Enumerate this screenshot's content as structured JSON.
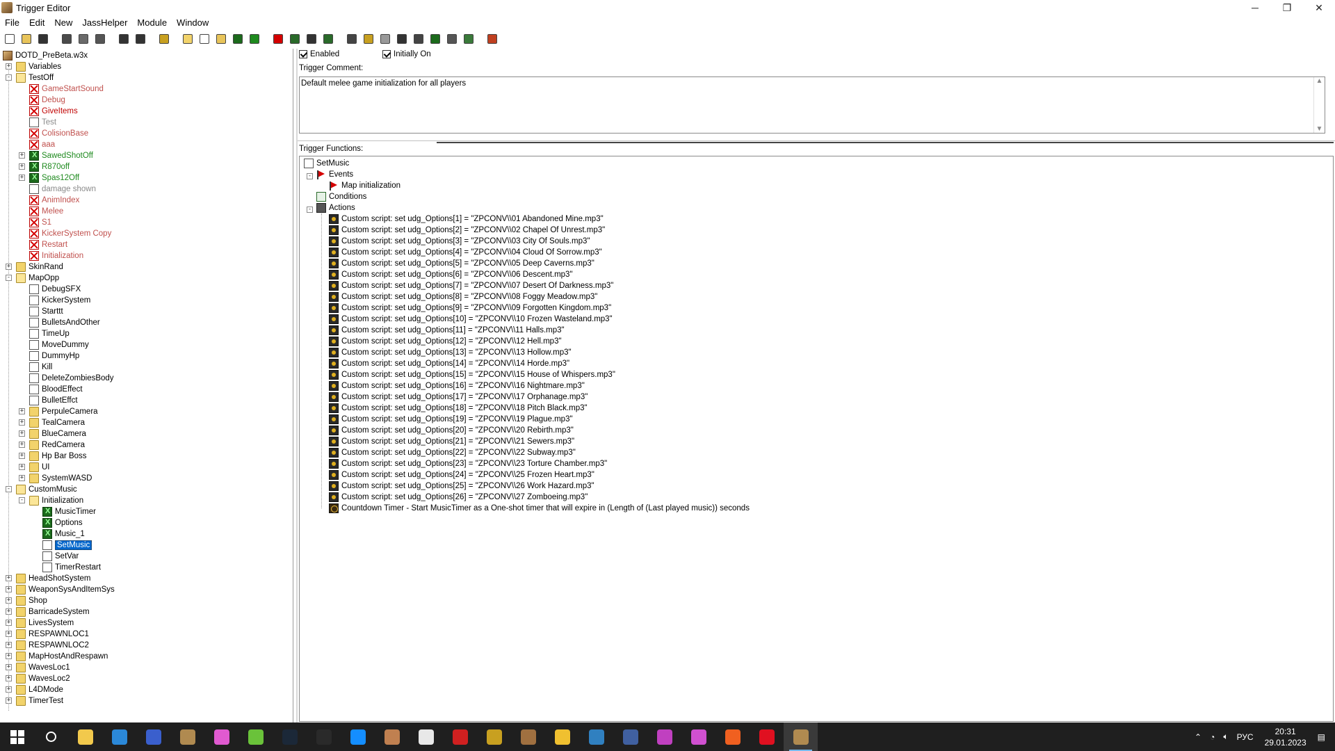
{
  "window": {
    "title": "Trigger Editor",
    "controls": [
      "─",
      "❐",
      "✕"
    ]
  },
  "menu": [
    "File",
    "Edit",
    "New",
    "JassHelper",
    "Module",
    "Window"
  ],
  "toolbar": {
    "buttons": [
      {
        "icon": "new-icon",
        "color": "#ffffff"
      },
      {
        "icon": "open-icon",
        "color": "#e8c45a"
      },
      {
        "icon": "save-icon",
        "color": "#333333"
      },
      {
        "icon": "cut-icon",
        "color": "#4a4a4a"
      },
      {
        "icon": "copy-icon",
        "color": "#6a6a6a"
      },
      {
        "icon": "paste-icon",
        "color": "#555555"
      },
      {
        "icon": "undo-icon",
        "color": "#333333"
      },
      {
        "icon": "redo-icon",
        "color": "#333333"
      },
      {
        "icon": "delete-icon",
        "color": "#c8a020"
      },
      {
        "icon": "new-category-icon",
        "color": "#f2d36b"
      },
      {
        "icon": "new-trigger-icon",
        "color": "#ffffff"
      },
      {
        "icon": "new-comment-icon",
        "color": "#e8c45a"
      },
      {
        "icon": "new-variable-icon",
        "color": "#1c6a1c"
      },
      {
        "icon": "jass-icon",
        "color": "#1e8a1e"
      },
      {
        "icon": "event-icon",
        "color": "#d40000"
      },
      {
        "icon": "condition-icon",
        "color": "#2a6a2a"
      },
      {
        "icon": "action-icon",
        "color": "#333333"
      },
      {
        "icon": "checklist-icon",
        "color": "#2a6a2a"
      },
      {
        "icon": "terrain-icon",
        "color": "#444444"
      },
      {
        "icon": "object-icon",
        "color": "#c8a020"
      },
      {
        "icon": "sound-icon",
        "color": "#999999"
      },
      {
        "icon": "ai-icon",
        "color": "#333333"
      },
      {
        "icon": "campaign-icon",
        "color": "#444444"
      },
      {
        "icon": "import-icon",
        "color": "#1c6a1c"
      },
      {
        "icon": "object-manager-icon",
        "color": "#555555"
      },
      {
        "icon": "test-map-icon",
        "color": "#3a7a3a"
      },
      {
        "icon": "script-test-icon",
        "color": "#c04020"
      }
    ]
  },
  "tree": {
    "root": "DOTD_PreBeta.w3x",
    "items": [
      {
        "label": "Variables",
        "icon": "folder-icon",
        "style": "normal",
        "level": 1,
        "expander": "+"
      },
      {
        "label": "TestOff",
        "icon": "folder-open-icon",
        "style": "normal",
        "level": 1,
        "expander": "-"
      },
      {
        "label": "GameStartSound",
        "icon": "disabled-trigger-icon",
        "style": "disabled",
        "level": 2,
        "expander": ""
      },
      {
        "label": "Debug",
        "icon": "disabled-trigger-icon",
        "style": "disabled",
        "level": 2,
        "expander": ""
      },
      {
        "label": "GiveItems",
        "icon": "disabled-trigger-icon",
        "style": "disabled-strong",
        "level": 2,
        "expander": ""
      },
      {
        "label": "Test",
        "icon": "document-icon",
        "style": "gray",
        "level": 2,
        "expander": ""
      },
      {
        "label": "ColisionBase",
        "icon": "disabled-trigger-icon",
        "style": "disabled",
        "level": 2,
        "expander": ""
      },
      {
        "label": "aaa",
        "icon": "disabled-trigger-icon",
        "style": "disabled",
        "level": 2,
        "expander": ""
      },
      {
        "label": "SawedShotOff",
        "icon": "jass-trigger-icon",
        "style": "green",
        "level": 2,
        "expander": "+"
      },
      {
        "label": "R870off",
        "icon": "jass-trigger-icon",
        "style": "green",
        "level": 2,
        "expander": "+"
      },
      {
        "label": "Spas12Off",
        "icon": "jass-trigger-icon",
        "style": "green",
        "level": 2,
        "expander": "+"
      },
      {
        "label": "damage shown",
        "icon": "document-icon",
        "style": "gray",
        "level": 2,
        "expander": ""
      },
      {
        "label": "AnimIndex",
        "icon": "disabled-trigger-icon",
        "style": "disabled",
        "level": 2,
        "expander": ""
      },
      {
        "label": "Melee",
        "icon": "disabled-trigger-icon",
        "style": "disabled",
        "level": 2,
        "expander": ""
      },
      {
        "label": "S1",
        "icon": "disabled-trigger-icon",
        "style": "disabled",
        "level": 2,
        "expander": ""
      },
      {
        "label": "KickerSystem Copy",
        "icon": "disabled-trigger-icon",
        "style": "disabled",
        "level": 2,
        "expander": ""
      },
      {
        "label": "Restart",
        "icon": "disabled-trigger-icon",
        "style": "disabled",
        "level": 2,
        "expander": ""
      },
      {
        "label": "Initialization",
        "icon": "disabled-trigger-icon",
        "style": "disabled",
        "level": 2,
        "expander": ""
      },
      {
        "label": "SkinRand",
        "icon": "folder-icon",
        "style": "normal",
        "level": 1,
        "expander": "+"
      },
      {
        "label": "MapOpp",
        "icon": "folder-open-icon",
        "style": "normal",
        "level": 1,
        "expander": "-"
      },
      {
        "label": "DebugSFX",
        "icon": "document-icon",
        "style": "normal",
        "level": 2,
        "expander": ""
      },
      {
        "label": "KickerSystem",
        "icon": "document-icon",
        "style": "normal",
        "level": 2,
        "expander": ""
      },
      {
        "label": "Starttt",
        "icon": "document-icon",
        "style": "normal",
        "level": 2,
        "expander": ""
      },
      {
        "label": "BulletsAndOther",
        "icon": "document-icon",
        "style": "normal",
        "level": 2,
        "expander": ""
      },
      {
        "label": "TimeUp",
        "icon": "document-icon",
        "style": "normal",
        "level": 2,
        "expander": ""
      },
      {
        "label": "MoveDummy",
        "icon": "document-icon",
        "style": "normal",
        "level": 2,
        "expander": ""
      },
      {
        "label": "DummyHp",
        "icon": "document-icon",
        "style": "normal",
        "level": 2,
        "expander": ""
      },
      {
        "label": "Kill",
        "icon": "document-icon",
        "style": "normal",
        "level": 2,
        "expander": ""
      },
      {
        "label": "DeleteZombiesBody",
        "icon": "document-icon",
        "style": "normal",
        "level": 2,
        "expander": ""
      },
      {
        "label": "BloodEffect",
        "icon": "document-icon",
        "style": "normal",
        "level": 2,
        "expander": ""
      },
      {
        "label": "BulletEffct",
        "icon": "document-icon",
        "style": "normal",
        "level": 2,
        "expander": ""
      },
      {
        "label": "PerpuleCamera",
        "icon": "folder-icon",
        "style": "normal",
        "level": 2,
        "expander": "+"
      },
      {
        "label": "TealCamera",
        "icon": "folder-icon",
        "style": "normal",
        "level": 2,
        "expander": "+"
      },
      {
        "label": "BlueCamera",
        "icon": "folder-icon",
        "style": "normal",
        "level": 2,
        "expander": "+"
      },
      {
        "label": "RedCamera",
        "icon": "folder-icon",
        "style": "normal",
        "level": 2,
        "expander": "+"
      },
      {
        "label": "Hp Bar Boss",
        "icon": "folder-icon",
        "style": "normal",
        "level": 2,
        "expander": "+"
      },
      {
        "label": "UI",
        "icon": "folder-icon",
        "style": "normal",
        "level": 2,
        "expander": "+"
      },
      {
        "label": "SystemWASD",
        "icon": "folder-icon",
        "style": "normal",
        "level": 2,
        "expander": "+"
      },
      {
        "label": "CustomMusic",
        "icon": "folder-open-icon",
        "style": "normal",
        "level": 1,
        "expander": "-"
      },
      {
        "label": "Initialization",
        "icon": "folder-open-icon",
        "style": "normal",
        "level": 2,
        "expander": "-"
      },
      {
        "label": "MusicTimer",
        "icon": "jass-trigger-icon",
        "style": "normal",
        "level": 3,
        "expander": ""
      },
      {
        "label": "Options",
        "icon": "jass-trigger-icon",
        "style": "normal",
        "level": 3,
        "expander": ""
      },
      {
        "label": "Music_1",
        "icon": "jass-trigger-icon",
        "style": "normal",
        "level": 3,
        "expander": ""
      },
      {
        "label": "SetMusic",
        "icon": "document-icon",
        "style": "selected",
        "level": 3,
        "expander": ""
      },
      {
        "label": "SetVar",
        "icon": "document-icon",
        "style": "normal",
        "level": 3,
        "expander": ""
      },
      {
        "label": "TimerRestart",
        "icon": "document-icon",
        "style": "normal",
        "level": 3,
        "expander": ""
      },
      {
        "label": "HeadShotSystem",
        "icon": "folder-icon",
        "style": "normal",
        "level": 1,
        "expander": "+"
      },
      {
        "label": "WeaponSysAndItemSys",
        "icon": "folder-icon",
        "style": "normal",
        "level": 1,
        "expander": "+"
      },
      {
        "label": "Shop",
        "icon": "folder-icon",
        "style": "normal",
        "level": 1,
        "expander": "+"
      },
      {
        "label": "BarricadeSystem",
        "icon": "folder-icon",
        "style": "normal",
        "level": 1,
        "expander": "+"
      },
      {
        "label": "LivesSystem",
        "icon": "folder-icon",
        "style": "normal",
        "level": 1,
        "expander": "+"
      },
      {
        "label": "RESPAWNLOC1",
        "icon": "folder-icon",
        "style": "normal",
        "level": 1,
        "expander": "+"
      },
      {
        "label": "RESPAWNLOC2",
        "icon": "folder-icon",
        "style": "normal",
        "level": 1,
        "expander": "+"
      },
      {
        "label": "MapHostAndRespawn",
        "icon": "folder-icon",
        "style": "normal",
        "level": 1,
        "expander": "+"
      },
      {
        "label": "WavesLoc1",
        "icon": "folder-icon",
        "style": "normal",
        "level": 1,
        "expander": "+"
      },
      {
        "label": "WavesLoc2",
        "icon": "folder-icon",
        "style": "normal",
        "level": 1,
        "expander": "+"
      },
      {
        "label": "L4DMode",
        "icon": "folder-icon",
        "style": "normal",
        "level": 1,
        "expander": "+"
      },
      {
        "label": "TimerTest",
        "icon": "folder-icon",
        "style": "normal",
        "level": 1,
        "expander": "+"
      }
    ]
  },
  "trigger": {
    "enabled_label": "Enabled",
    "initially_on_label": "Initially On",
    "comment_label": "Trigger Comment:",
    "comment": "Default melee game initialization for all players",
    "functions_label": "Trigger Functions:",
    "name": "SetMusic",
    "events_label": "Events",
    "events": [
      "Map initialization"
    ],
    "conditions_label": "Conditions",
    "actions_label": "Actions",
    "actions": [
      "Custom script:   set udg_Options[1] = \"ZPCONV\\\\01 Abandoned Mine.mp3\"",
      "Custom script:   set udg_Options[2] = \"ZPCONV\\\\02 Chapel Of Unrest.mp3\"",
      "Custom script:   set udg_Options[3] = \"ZPCONV\\\\03 City Of Souls.mp3\"",
      "Custom script:   set udg_Options[4] = \"ZPCONV\\\\04 Cloud Of Sorrow.mp3\"",
      "Custom script:   set udg_Options[5] = \"ZPCONV\\\\05 Deep Caverns.mp3\"",
      "Custom script:   set udg_Options[6] = \"ZPCONV\\\\06 Descent.mp3\"",
      "Custom script:   set udg_Options[7] = \"ZPCONV\\\\07 Desert Of Darkness.mp3\"",
      "Custom script:   set udg_Options[8] = \"ZPCONV\\\\08 Foggy Meadow.mp3\"",
      "Custom script:   set udg_Options[9] = \"ZPCONV\\\\09 Forgotten Kingdom.mp3\"",
      "Custom script:   set udg_Options[10] = \"ZPCONV\\\\10 Frozen Wasteland.mp3\"",
      "Custom script:   set udg_Options[11] = \"ZPCONV\\\\11 Halls.mp3\"",
      "Custom script:   set udg_Options[12] = \"ZPCONV\\\\12 Hell.mp3\"",
      "Custom script:   set udg_Options[13] = \"ZPCONV\\\\13 Hollow.mp3\"",
      "Custom script:   set udg_Options[14] = \"ZPCONV\\\\14 Horde.mp3\"",
      "Custom script:   set udg_Options[15] = \"ZPCONV\\\\15 House of Whispers.mp3\"",
      "Custom script:   set udg_Options[16] = \"ZPCONV\\\\16 Nightmare.mp3\"",
      "Custom script:   set udg_Options[17] = \"ZPCONV\\\\17 Orphanage.mp3\"",
      "Custom script:   set udg_Options[18] = \"ZPCONV\\\\18 Pitch Black.mp3\"",
      "Custom script:   set udg_Options[19] = \"ZPCONV\\\\19 Plague.mp3\"",
      "Custom script:   set udg_Options[20] = \"ZPCONV\\\\20 Rebirth.mp3\"",
      "Custom script:   set udg_Options[21] = \"ZPCONV\\\\21 Sewers.mp3\"",
      "Custom script:   set udg_Options[22] = \"ZPCONV\\\\22 Subway.mp3\"",
      "Custom script:   set udg_Options[23] = \"ZPCONV\\\\23 Torture Chamber.mp3\"",
      "Custom script:   set udg_Options[24] = \"ZPCONV\\\\25 Frozen Heart.mp3\"",
      "Custom script:   set udg_Options[25] = \"ZPCONV\\\\26 Work Hazard.mp3\"",
      "Custom script:   set udg_Options[26] = \"ZPCONV\\\\27 Zomboeing.mp3\""
    ],
    "timer_action": "Countdown Timer - Start MusicTimer as a One-shot timer that will expire in (Length of (Last played music)) seconds"
  },
  "taskbar": {
    "apps": [
      {
        "icon": "start-icon",
        "color": "#ffffff"
      },
      {
        "icon": "search-icon",
        "color": "#ffffff"
      },
      {
        "icon": "file-explorer-icon",
        "color": "#f2c94c"
      },
      {
        "icon": "mail-icon",
        "color": "#2b88d8"
      },
      {
        "icon": "floppy-icon",
        "color": "#3a5fcd"
      },
      {
        "icon": "world-editor-icon",
        "color": "#b08a50"
      },
      {
        "icon": "drop-icon",
        "color": "#e05ad0"
      },
      {
        "icon": "utorrent-icon",
        "color": "#6ac23a"
      },
      {
        "icon": "steam-icon",
        "color": "#1b2838"
      },
      {
        "icon": "epic-games-icon",
        "color": "#2a2a2a"
      },
      {
        "icon": "battlenet-icon",
        "color": "#148eff"
      },
      {
        "icon": "avatar-icon",
        "color": "#c08050"
      },
      {
        "icon": "box-icon",
        "color": "#e8e8e8"
      },
      {
        "icon": "game-red-icon",
        "color": "#d02020"
      },
      {
        "icon": "warcraft-icon",
        "color": "#c8a020"
      },
      {
        "icon": "character-icon",
        "color": "#a07040"
      },
      {
        "icon": "palette-icon",
        "color": "#f0c030"
      },
      {
        "icon": "globe-icon",
        "color": "#3080c0"
      },
      {
        "icon": "window-icon",
        "color": "#4060a0"
      },
      {
        "icon": "pink-app-icon",
        "color": "#c040c0"
      },
      {
        "icon": "pink-app-2-icon",
        "color": "#d050d0"
      },
      {
        "icon": "origin-icon",
        "color": "#f06020"
      },
      {
        "icon": "opera-icon",
        "color": "#e01020"
      },
      {
        "icon": "trigger-editor-icon",
        "color": "#b08a50"
      }
    ],
    "lang": "РУС",
    "time": "20:31",
    "date": "29.01.2023"
  }
}
